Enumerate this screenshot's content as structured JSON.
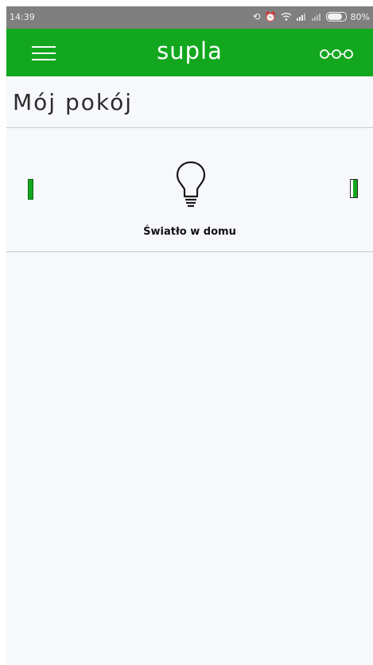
{
  "status_bar": {
    "time": "14:39",
    "battery_percent_text": "80%",
    "battery_level": 0.8,
    "icons": [
      "sync-icon",
      "alarm-off-icon",
      "wifi-icon",
      "signal-icon",
      "signal-weak-icon",
      "battery-icon"
    ]
  },
  "app_bar": {
    "title": "supla",
    "menu_icon": "hamburger-menu-icon",
    "overflow_icon": "three-circles-icon",
    "color": "#12a71e"
  },
  "location": {
    "name": "Mój pokój"
  },
  "channels": [
    {
      "caption": "Światło w domu",
      "icon": "light-bulb-icon",
      "state": "off",
      "left_indicator_color": "#12a71e",
      "right_indicator_color": "#12a71e"
    }
  ],
  "colors": {
    "accent": "#12a71e",
    "background": "#f6f8fb",
    "status_bar": "#7f7f7f"
  }
}
